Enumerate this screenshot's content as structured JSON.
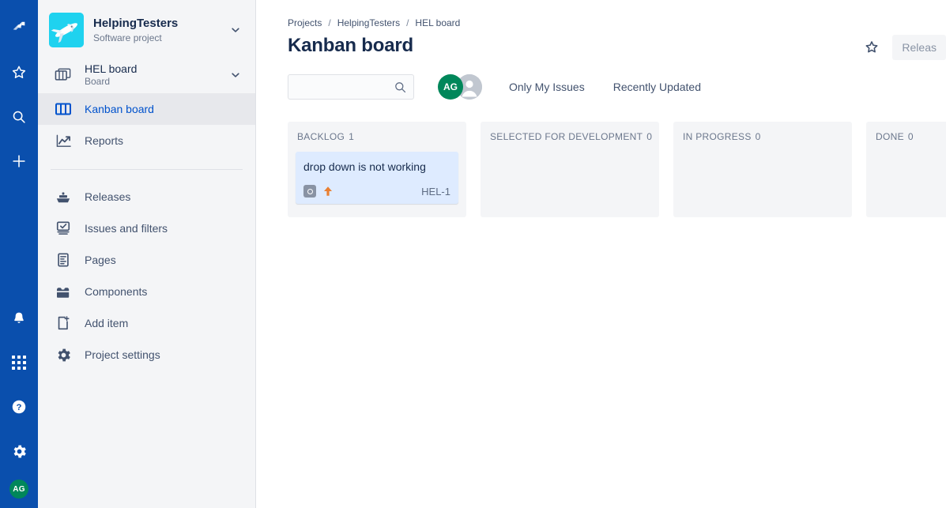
{
  "rail": {
    "top_items": [
      {
        "name": "jira-logo",
        "label": "Jira"
      },
      {
        "name": "starred-icon",
        "label": "Starred"
      },
      {
        "name": "search-icon",
        "label": "Search"
      },
      {
        "name": "create-icon",
        "label": "Create"
      }
    ],
    "bottom_items": [
      {
        "name": "notifications-icon",
        "label": "Notifications"
      },
      {
        "name": "app-switcher-icon",
        "label": "App switcher"
      },
      {
        "name": "help-icon",
        "label": "Help"
      },
      {
        "name": "settings-icon",
        "label": "Settings"
      }
    ],
    "avatar_initials": "AG"
  },
  "sidebar": {
    "project": {
      "name": "HelpingTesters",
      "type": "Software project",
      "avatar_icon": "airplane-icon"
    },
    "board": {
      "title": "HEL board",
      "subtitle": "Board",
      "icon": "boards-stack-icon"
    },
    "board_items": [
      {
        "label": "Kanban board",
        "icon": "board-columns-icon",
        "active": true
      },
      {
        "label": "Reports",
        "icon": "reports-chart-icon",
        "active": false
      }
    ],
    "project_items": [
      {
        "label": "Releases",
        "icon": "ship-icon"
      },
      {
        "label": "Issues and filters",
        "icon": "issues-filters-icon"
      },
      {
        "label": "Pages",
        "icon": "page-document-icon"
      },
      {
        "label": "Components",
        "icon": "components-icon"
      },
      {
        "label": "Add item",
        "icon": "add-item-icon"
      },
      {
        "label": "Project settings",
        "icon": "gear-icon"
      }
    ]
  },
  "header": {
    "breadcrumbs": [
      "Projects",
      "HelpingTesters",
      "HEL board"
    ],
    "breadcrumb_separator": "/",
    "title": "Kanban board",
    "star_icon": "star-outline-icon",
    "release_button": "Releas"
  },
  "toolbar": {
    "search_value": "",
    "search_placeholder": "",
    "search_icon": "search-icon",
    "avatars": [
      {
        "initials": "AG",
        "type": "user"
      },
      {
        "initials": "",
        "type": "default-user"
      }
    ],
    "filters": [
      "Only My Issues",
      "Recently Updated"
    ]
  },
  "board": {
    "columns": [
      {
        "name": "BACKLOG",
        "count": "1",
        "cards": [
          {
            "title": "drop down is not working",
            "key": "HEL-1",
            "type_icon": "task-icon",
            "priority_icon": "priority-high-up-arrow-icon"
          }
        ]
      },
      {
        "name": "SELECTED FOR DEVELOPMENT",
        "count": "0",
        "cards": []
      },
      {
        "name": "IN PROGRESS",
        "count": "0",
        "cards": []
      },
      {
        "name": "DONE",
        "count": "0",
        "cards": []
      }
    ]
  },
  "colors": {
    "rail_bg": "#0a4fad",
    "sidebar_bg": "#f4f5f7",
    "link": "#0052cc",
    "text": "#172b4d",
    "muted": "#6b778c",
    "card_bg": "#deebff",
    "avatar_green": "#00875a",
    "priority_orange": "#e97f33",
    "project_avatar": "#1fd2ef"
  }
}
